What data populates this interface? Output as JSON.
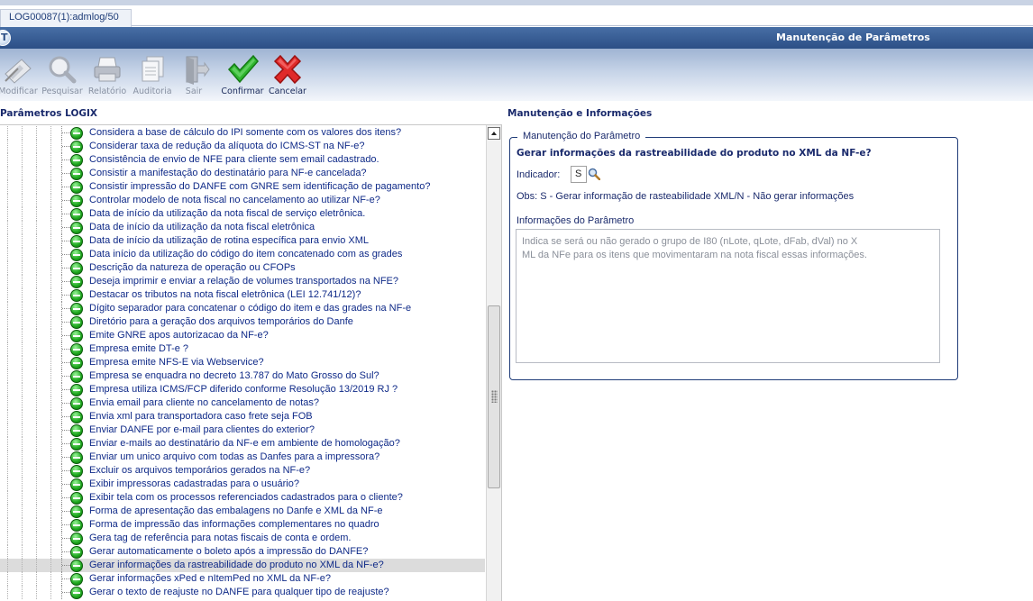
{
  "tab": {
    "label": "LOG00087(1):admlog/50"
  },
  "window": {
    "title": "Manutenção de Parâmetros",
    "logo_letter": "T"
  },
  "toolbar": {
    "modificar": "Modificar",
    "pesquisar": "Pesquisar",
    "relatorio": "Relatório",
    "auditoria": "Auditoria",
    "sair": "Sair",
    "confirmar": "Confirmar",
    "cancelar": "Cancelar"
  },
  "left_panel": {
    "title": "Parâmetros LOGIX"
  },
  "tree": {
    "items": [
      "Considera a base de cálculo do IPI somente com os valores dos itens?",
      "Considerar taxa de redução da alíquota do ICMS-ST na NF-e?",
      "Consistência de envio de NFE para cliente sem email cadastrado.",
      "Consistir a manifestação do destinatário para NF-e cancelada?",
      "Consistir impressão do DANFE com GNRE sem identificação de pagamento?",
      "Controlar modelo de nota fiscal no cancelamento ao utilizar NF-e?",
      "Data de início da utilização da nota fiscal de serviço eletrônica.",
      "Data de início da utilização da nota fiscal eletrônica",
      "Data de início da utilização de rotina específica para envio XML",
      "Data início da utilização do código do item concatenado com as grades",
      "Descrição da natureza de operação ou CFOPs",
      "Deseja imprimir e enviar a relação de volumes transportados na NFE?",
      "Destacar os tributos na nota fiscal eletrônica (LEI 12.741/12)?",
      "Dígito separador para concatenar o código do item e das grades na NF-e",
      "Diretório para a geração dos arquivos temporários do Danfe",
      "Emite GNRE apos autorizacao da NF-e?",
      "Empresa emite DT-e ?",
      "Empresa emite NFS-E via Webservice?",
      "Empresa se enquadra no decreto 13.787 do Mato Grosso do Sul?",
      "Empresa utiliza ICMS/FCP diferido conforme Resolução 13/2019 RJ ?",
      "Envia email para cliente no cancelamento de notas?",
      "Envia xml para transportadora caso frete seja FOB",
      "Enviar DANFE por e-mail para clientes do exterior?",
      "Enviar e-mails ao destinatário da NF-e em ambiente de homologação?",
      "Enviar um unico arquivo com todas as Danfes para a impressora?",
      "Excluir os arquivos temporários gerados na NF-e?",
      "Exibir impressoras cadastradas para o usuário?",
      "Exibir tela com os processos referenciados cadastrados para o cliente?",
      "Forma de apresentação das embalagens no Danfe e XML da NF-e",
      "Forma de impressão das informações complementares no quadro",
      "Gera tag de referência para notas fiscais de conta e ordem.",
      "Gerar automaticamente o boleto após a impressão do DANFE?",
      "Gerar informações da rastreabilidade do produto no XML da NF-e?",
      "Gerar informações xPed e nItemPed no XML da NF-e?",
      "Gerar o texto de reajuste no DANFE para qualquer tipo de reajuste?"
    ],
    "selected_index": 32
  },
  "right_panel": {
    "title": "Manutenção e Informações",
    "group_title": "Manutenção do Parâmetro",
    "question": "Gerar informações da rastreabilidade do produto no XML da NF-e?",
    "indicator_label": "Indicador:",
    "indicator_value": "S",
    "obs": "Obs: S - Gerar informação de rasteabilidade XML/N - Não gerar informações",
    "info_label": "Informações do Parâmetro",
    "info_line1": "Indica se será ou não gerado o grupo de I80 (nLote, qLote, dFab, dVal) no X",
    "info_line2": "ML da NFe para os itens que movimentaram na nota fiscal essas informações."
  }
}
